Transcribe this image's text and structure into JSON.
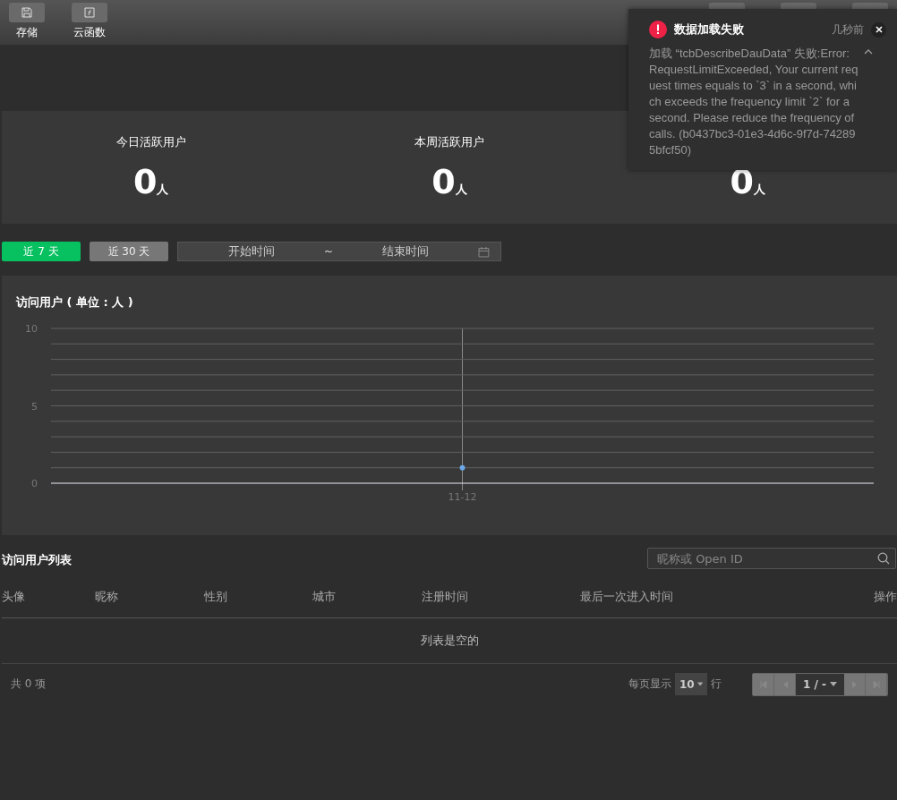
{
  "toolbar": {
    "buttons": [
      {
        "label": "存储",
        "kind": "save"
      },
      {
        "label": "云函数",
        "kind": "function"
      }
    ]
  },
  "stats": [
    {
      "label": "今日活跃用户",
      "value": "0",
      "unit": "人"
    },
    {
      "label": "本周活跃用户",
      "value": "0",
      "unit": "人"
    },
    {
      "value": "0",
      "unit": "人"
    }
  ],
  "range_buttons": [
    {
      "label": "近 7 天",
      "selected": true
    },
    {
      "label": "近 30 天",
      "selected": false
    }
  ],
  "date_range": {
    "start_placeholder": "开始时间",
    "separator": "~",
    "end_placeholder": "结束时间"
  },
  "chart": {
    "title": "访问用户 ( 单位 : 人 )",
    "chart_data": {
      "type": "line",
      "categories": [
        "11-12"
      ],
      "series": [
        {
          "color": "#6aa8e8",
          "marker": "circle",
          "values": [
            1
          ]
        }
      ],
      "ylim": [
        0,
        10
      ],
      "yticks": [
        0,
        5,
        10
      ]
    }
  },
  "table": {
    "title": "访问用户列表",
    "search": {
      "placeholder": "昵称或 Open ID"
    },
    "columns": [
      "头像",
      "昵称",
      "性别",
      "城市",
      "注册时间",
      "最后一次进入时间",
      "操作"
    ],
    "empty_text": "列表是空的",
    "total": "共 0 项",
    "page_size_label": "每页显示",
    "page_size": "10",
    "page_size_unit": "行",
    "page": "1 / -"
  },
  "toast": {
    "title": "数据加载失败",
    "time": "几秒前",
    "message": "加载 “tcbDescribeDauData” 失败:Error: RequestLimitExceeded, Your current request times equals to `3` in a second, which exceeds the frequency limit `2` for a second. Please reduce the frequency of calls. (b0437bc3-01e3-4d6c-9f7d-742895bfcf50)",
    "expanded": true
  }
}
